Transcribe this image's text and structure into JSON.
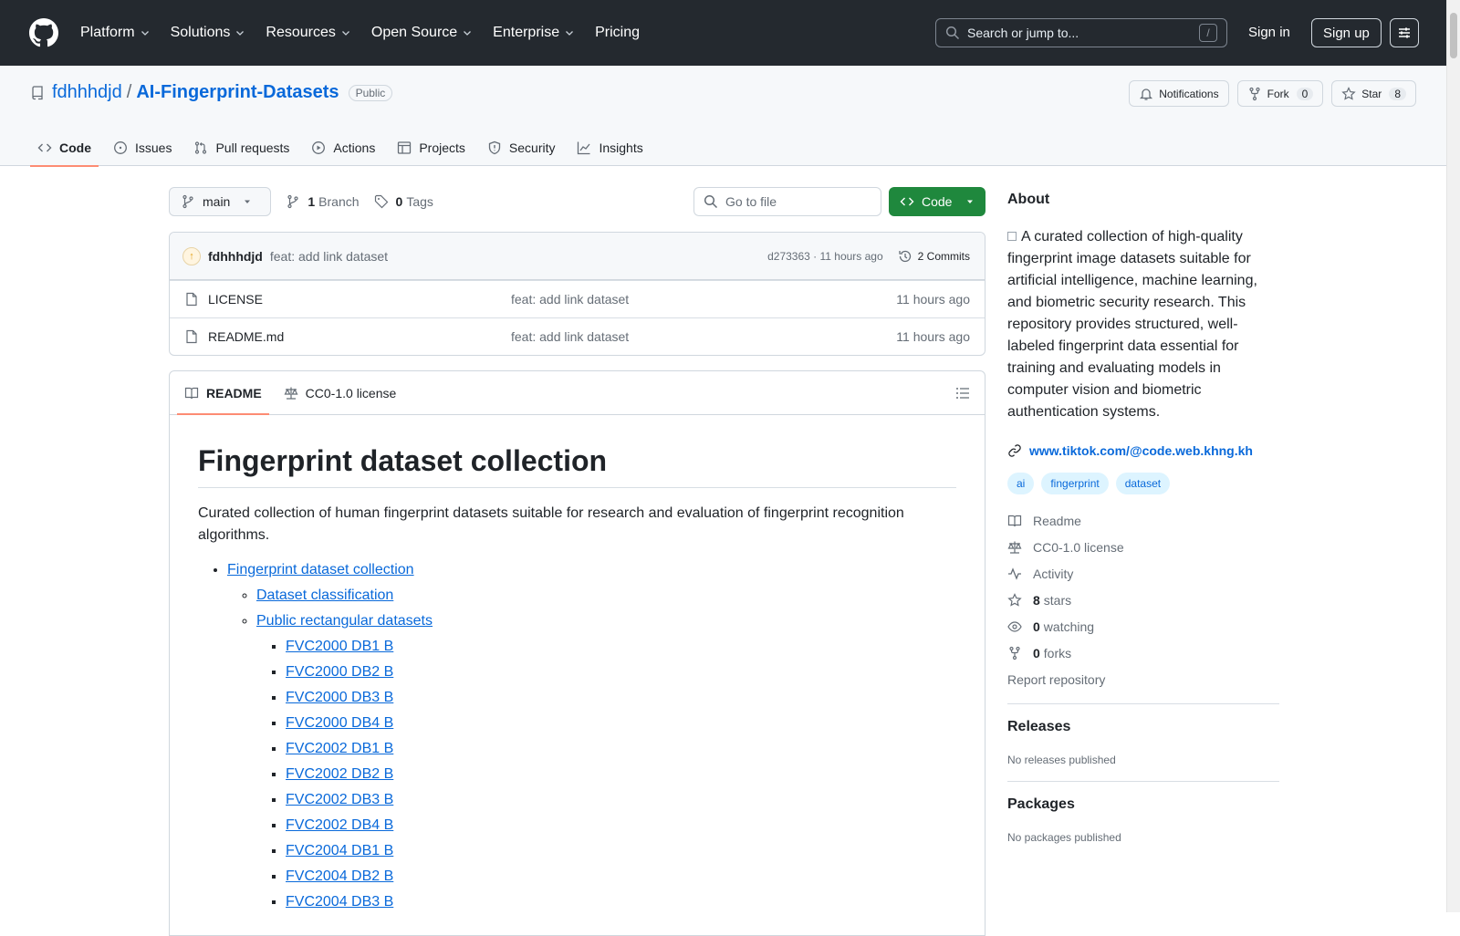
{
  "header": {
    "nav": [
      "Platform",
      "Solutions",
      "Resources",
      "Open Source",
      "Enterprise",
      "Pricing"
    ],
    "search_placeholder": "Search or jump to...",
    "slash_hint": "/",
    "sign_in": "Sign in",
    "sign_up": "Sign up"
  },
  "repo": {
    "owner": "fdhhhdjd",
    "separator": "/",
    "name": "AI-Fingerprint-Datasets",
    "visibility": "Public",
    "notifications": "Notifications",
    "fork_label": "Fork",
    "fork_count": "0",
    "star_label": "Star",
    "star_count": "8",
    "tabs": [
      "Code",
      "Issues",
      "Pull requests",
      "Actions",
      "Projects",
      "Security",
      "Insights"
    ]
  },
  "file_nav": {
    "branch": "main",
    "branch_count": "1",
    "branch_label": "Branch",
    "tag_count": "0",
    "tag_label": "Tags",
    "goto_placeholder": "Go to file",
    "code_button": "Code"
  },
  "commit": {
    "author": "fdhhhdjd",
    "message": "feat: add link dataset",
    "hash_time": "d273363 · 11 hours ago",
    "commits": "2 Commits"
  },
  "files": [
    {
      "name": "LICENSE",
      "message": "feat: add link dataset",
      "time": "11 hours ago"
    },
    {
      "name": "README.md",
      "message": "feat: add link dataset",
      "time": "11 hours ago"
    }
  ],
  "readme": {
    "tab_readme": "README",
    "tab_license": "CC0-1.0 license",
    "title": "Fingerprint dataset collection",
    "intro": "Curated collection of human fingerprint datasets suitable for research and evaluation of fingerprint recognition algorithms.",
    "toc_top": "Fingerprint dataset collection",
    "toc_sub1": "Dataset classification",
    "toc_sub2": "Public rectangular datasets",
    "toc_items": [
      "FVC2000 DB1 B",
      "FVC2000 DB2 B",
      "FVC2000 DB3 B",
      "FVC2000 DB4 B",
      "FVC2002 DB1 B",
      "FVC2002 DB2 B",
      "FVC2002 DB3 B",
      "FVC2002 DB4 B",
      "FVC2004 DB1 B",
      "FVC2004 DB2 B",
      "FVC2004 DB3 B"
    ]
  },
  "about": {
    "heading": "About",
    "description": "A curated collection of high-quality fingerprint image datasets suitable for artificial intelligence, machine learning, and biometric security research. This repository provides structured, well-labeled fingerprint data essential for training and evaluating models in computer vision and biometric authentication systems.",
    "website": "www.tiktok.com/@code.web.khng.kh",
    "topics": [
      "ai",
      "fingerprint",
      "dataset"
    ],
    "readme": "Readme",
    "license": "CC0-1.0 license",
    "activity": "Activity",
    "stars_count": "8",
    "stars_label": "stars",
    "watching_count": "0",
    "watching_label": "watching",
    "forks_count": "0",
    "forks_label": "forks",
    "report": "Report repository"
  },
  "releases": {
    "heading": "Releases",
    "empty": "No releases published"
  },
  "packages": {
    "heading": "Packages",
    "empty": "No packages published"
  },
  "colors": {
    "header_bg": "#24292f",
    "accent": "#0969da",
    "primary_button": "#1f883d",
    "tab_underline": "#fd8c73"
  }
}
